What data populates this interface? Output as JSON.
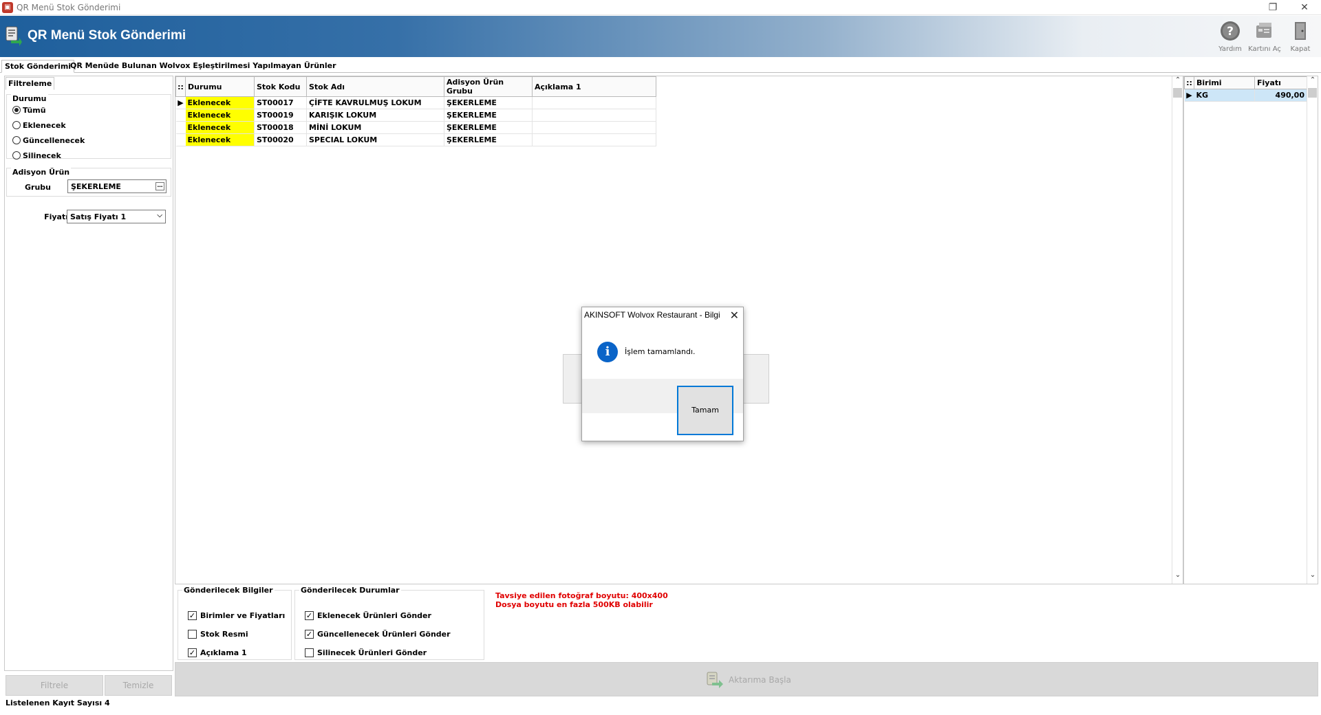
{
  "window": {
    "title": "QR Menü Stok Gönderimi",
    "restore_glyph": "❐",
    "close_glyph": "✕"
  },
  "header": {
    "title": "QR Menü Stok Gönderimi",
    "buttons": [
      {
        "label": "Yardım",
        "icon": "help-icon"
      },
      {
        "label": "Kartını Aç",
        "icon": "open-card-icon"
      },
      {
        "label": "Kapat",
        "icon": "exit-icon"
      }
    ]
  },
  "tabs": [
    {
      "label": "Stok Gönderimi",
      "active": true
    },
    {
      "label": "QR Menüde Bulunan Wolvox Eşleştirilmesi Yapılmayan Ürünler",
      "active": false
    }
  ],
  "filter": {
    "tab_label": "Filtreleme",
    "durum_title": "Durumu",
    "radios": [
      {
        "label": "Tümü",
        "checked": true
      },
      {
        "label": "Eklenecek",
        "checked": false
      },
      {
        "label": "Güncellenecek",
        "checked": false
      },
      {
        "label": "Silinecek",
        "checked": false
      }
    ],
    "adisyon_title": "Adisyon Ürün",
    "grubu_label": "Grubu",
    "grubu_value": "ŞEKERLEME",
    "fiyati_label": "Fiyatı",
    "fiyati_value": "Satış Fiyatı 1",
    "filter_button": "Filtrele",
    "clear_button": "Temizle"
  },
  "status": {
    "record_count_text": "Listelenen Kayıt Sayısı 4"
  },
  "main_grid": {
    "columns": [
      "Durumu",
      "Stok Kodu",
      "Stok Adı",
      "Adisyon Ürün Grubu",
      "Açıklama 1"
    ],
    "rows": [
      {
        "durum": "Eklenecek",
        "kod": "ST00017",
        "ad": "ÇİFTE KAVRULMUŞ LOKUM",
        "grup": "ŞEKERLEME",
        "aciklama": ""
      },
      {
        "durum": "Eklenecek",
        "kod": "ST00019",
        "ad": "KARIŞIK LOKUM",
        "grup": "ŞEKERLEME",
        "aciklama": ""
      },
      {
        "durum": "Eklenecek",
        "kod": "ST00018",
        "ad": "MİNİ LOKUM",
        "grup": "ŞEKERLEME",
        "aciklama": ""
      },
      {
        "durum": "Eklenecek",
        "kod": "ST00020",
        "ad": "SPECIAL LOKUM",
        "grup": "ŞEKERLEME",
        "aciklama": ""
      }
    ],
    "highlight_color": "#ffff00"
  },
  "price_grid": {
    "columns": [
      "Birimi",
      "Fiyatı"
    ],
    "rows": [
      {
        "birim": "KG",
        "fiyat": "490,00"
      }
    ],
    "selected_color": "#cde6f7"
  },
  "send_info": {
    "title": "Gönderilecek Bilgiler",
    "items": [
      {
        "label": "Birimler ve Fiyatları",
        "checked": true
      },
      {
        "label": "Stok Resmi",
        "checked": false
      },
      {
        "label": "Açıklama 1",
        "checked": true
      }
    ]
  },
  "send_status": {
    "title": "Gönderilecek Durumlar",
    "items": [
      {
        "label": "Eklenecek Ürünleri Gönder",
        "checked": true
      },
      {
        "label": "Güncellenecek Ürünleri Gönder",
        "checked": true
      },
      {
        "label": "Silinecek Ürünleri Gönder",
        "checked": false
      }
    ]
  },
  "warning": {
    "line1": "Tavsiye edilen fotoğraf boyutu: 400x400",
    "line2": "Dosya boyutu en fazla 500KB olabilir",
    "color": "#e00000"
  },
  "start_button": {
    "label": "Aktarıma Başla"
  },
  "dialog": {
    "title": "AKINSOFT Wolvox Restaurant - Bilgi",
    "message": "İşlem tamamlandı.",
    "ok_label": "Tamam",
    "accent": "#0078d7"
  }
}
